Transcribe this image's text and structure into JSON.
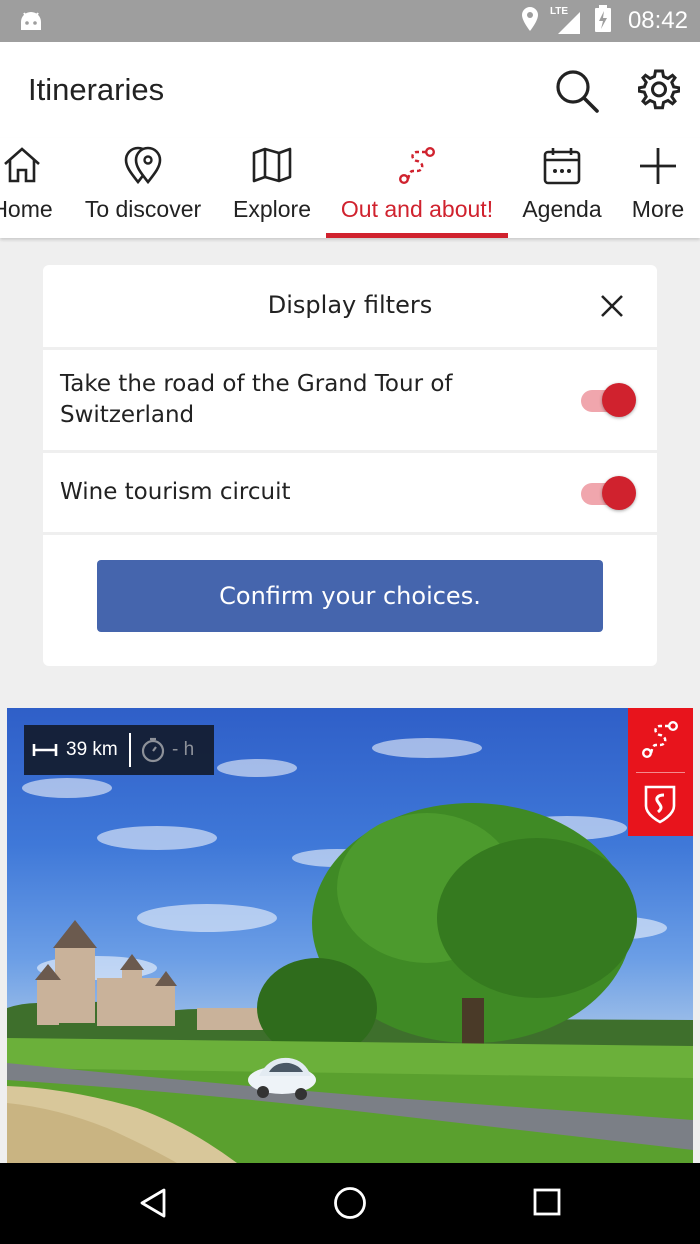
{
  "status_bar": {
    "time": "08:42",
    "network": "LTE",
    "icons": [
      "android-icon",
      "location-icon",
      "signal-icon",
      "battery-charging-icon"
    ]
  },
  "app_bar": {
    "title": "Itineraries",
    "actions": [
      "search-icon",
      "gear-icon"
    ]
  },
  "tabs": [
    {
      "label": "Home",
      "icon": "home-icon"
    },
    {
      "label": "To discover",
      "icon": "map-pins-icon"
    },
    {
      "label": "Explore",
      "icon": "map-icon"
    },
    {
      "label": "Out and about!",
      "icon": "route-icon",
      "active": true
    },
    {
      "label": "Agenda",
      "icon": "calendar-icon"
    },
    {
      "label": "More",
      "icon": "plus-icon"
    }
  ],
  "filters": {
    "title": "Display filters",
    "items": [
      {
        "label": "Take the road of the Grand Tour of Switzerland",
        "enabled": true
      },
      {
        "label": "Wine tourism circuit",
        "enabled": true
      }
    ],
    "confirm_label": "Confirm your choices."
  },
  "itinerary_card": {
    "distance": "39 km",
    "duration": "- h",
    "badges": [
      "route-icon",
      "grand-tour-logo-icon"
    ]
  },
  "nav_bar": {
    "buttons": [
      "back-icon",
      "home-circle-icon",
      "recents-icon"
    ]
  },
  "colors": {
    "accent": "#d0222e",
    "confirm_button": "#4565ad",
    "badge_red": "#e8141c",
    "status_bar": "#9e9e9e",
    "background": "#efefef"
  }
}
